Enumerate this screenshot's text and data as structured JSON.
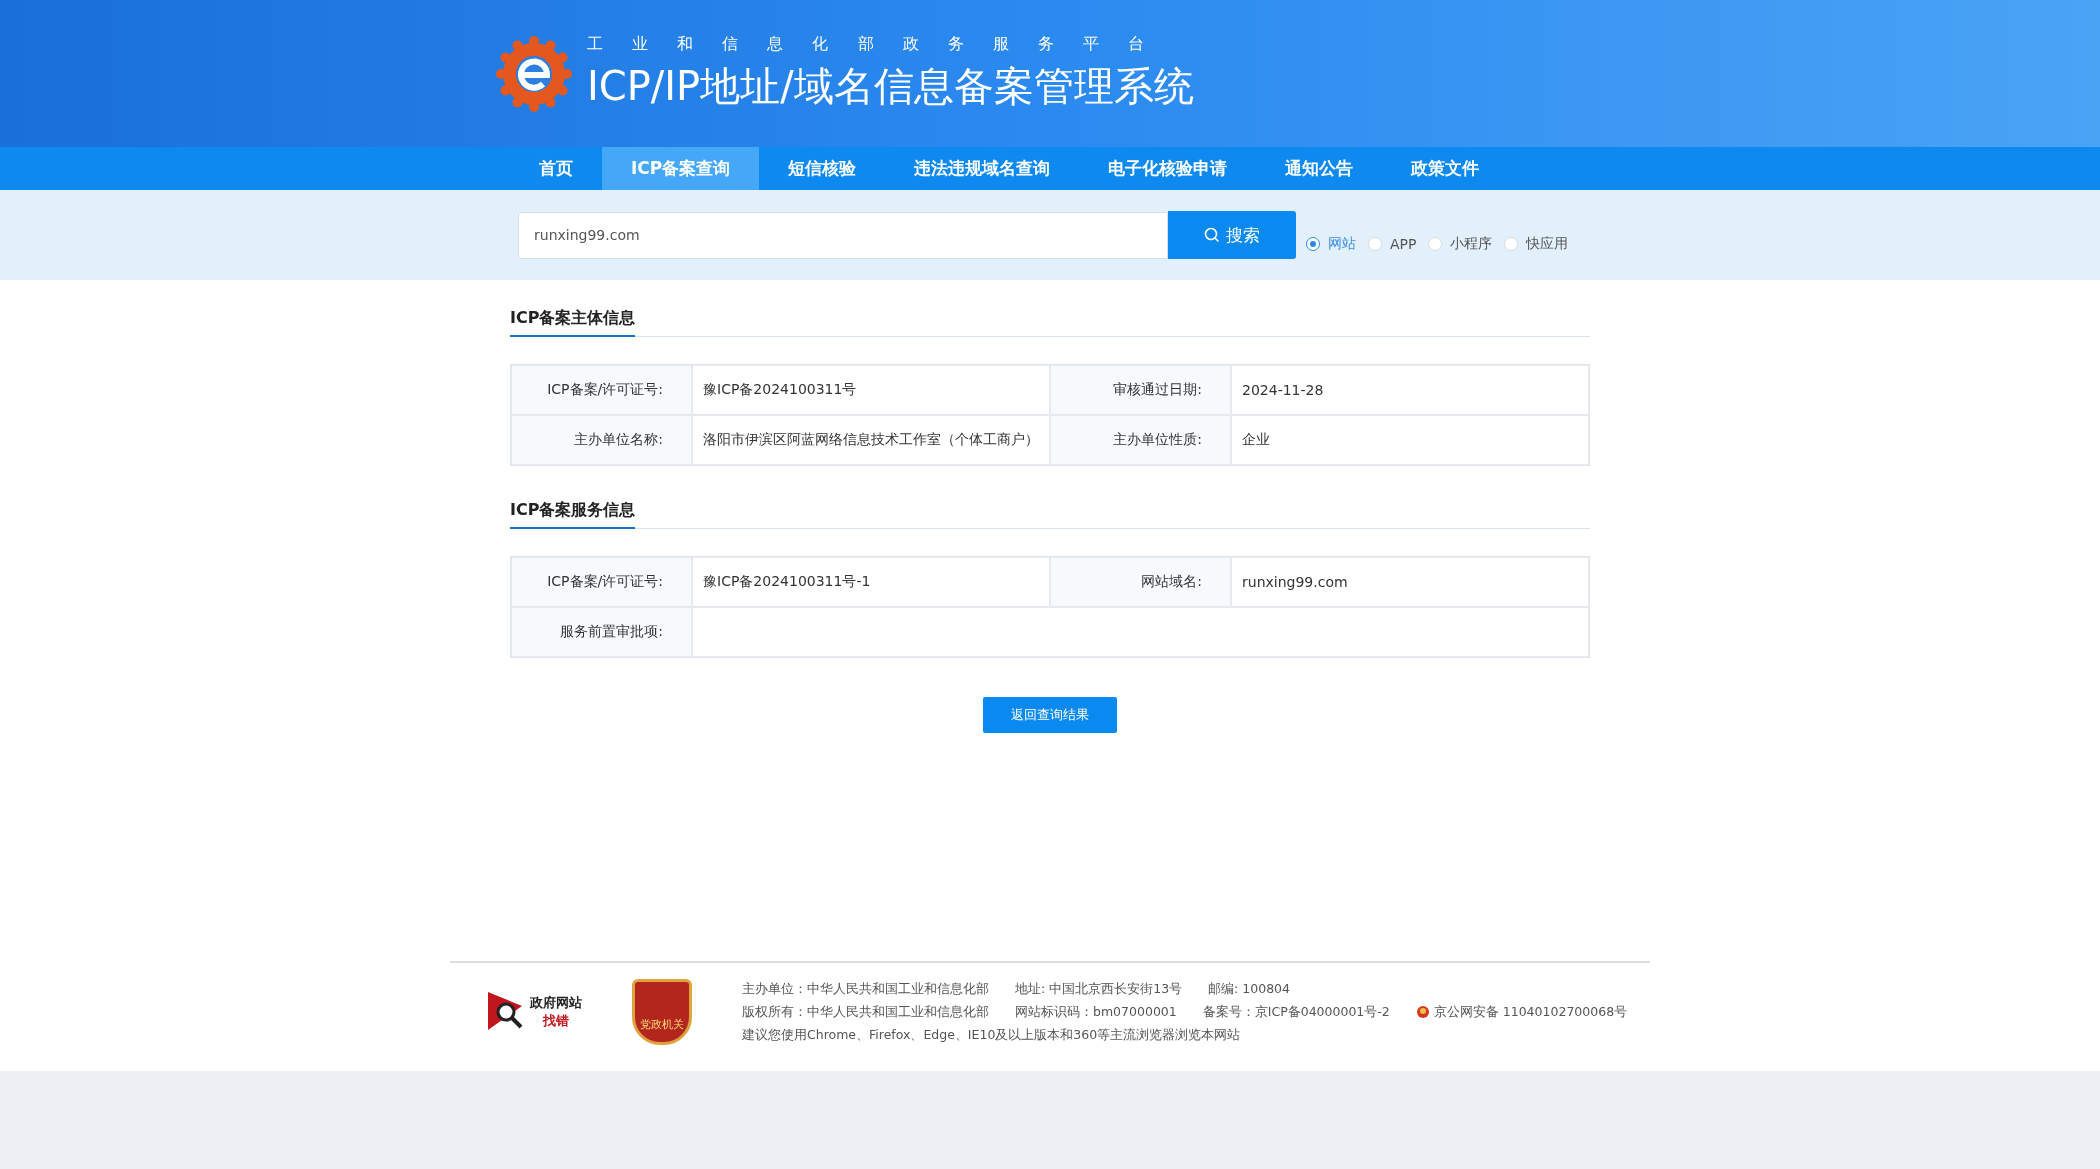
{
  "header": {
    "subtitle": "工 业 和 信 息 化 部 政 务 服 务 平 台",
    "title": "ICP/IP地址/域名信息备案管理系统"
  },
  "nav": [
    {
      "label": "首页",
      "selected": false
    },
    {
      "label": "ICP备案查询",
      "selected": true
    },
    {
      "label": "短信核验",
      "selected": false
    },
    {
      "label": "违法违规域名查询",
      "selected": false
    },
    {
      "label": "电子化核验申请",
      "selected": false
    },
    {
      "label": "通知公告",
      "selected": false
    },
    {
      "label": "政策文件",
      "selected": false
    }
  ],
  "search": {
    "value": "runxing99.com",
    "button": "搜索",
    "types": [
      {
        "label": "网站",
        "selected": true
      },
      {
        "label": "APP",
        "selected": false
      },
      {
        "label": "小程序",
        "selected": false
      },
      {
        "label": "快应用",
        "selected": false
      }
    ]
  },
  "sections": [
    {
      "title": "ICP备案主体信息",
      "rows": [
        [
          {
            "label": "ICP备案/许可证号:",
            "value": "豫ICP备2024100311号"
          },
          {
            "label": "审核通过日期:",
            "value": "2024-11-28"
          }
        ],
        [
          {
            "label": "主办单位名称:",
            "value": "洛阳市伊滨区阿蓝网络信息技术工作室（个体工商户）"
          },
          {
            "label": "主办单位性质:",
            "value": "企业"
          }
        ]
      ]
    },
    {
      "title": "ICP备案服务信息",
      "rows": [
        [
          {
            "label": "ICP备案/许可证号:",
            "value": "豫ICP备2024100311号-1"
          },
          {
            "label": "网站域名:",
            "value": "runxing99.com"
          }
        ],
        [
          {
            "label": "服务前置审批项:"
          }
        ]
      ]
    }
  ],
  "back_button": "返回查询结果",
  "footer": {
    "badge_gov": {
      "line1": "政府网站",
      "line2": "找错"
    },
    "badge_party": "党政机关",
    "lines": [
      [
        "主办单位：中华人民共和国工业和信息化部",
        "地址: 中国北京西长安街13号",
        "邮编: 100804"
      ],
      [
        "版权所有：中华人民共和国工业和信息化部",
        "网站标识码：bm07000001",
        "备案号：京ICP备04000001号-2"
      ],
      [
        "建议您使用Chrome、Firefox、Edge、IE10及以上版本和360等主流浏览器浏览本网站"
      ]
    ],
    "police": "京公网安备 11040102700068号"
  }
}
